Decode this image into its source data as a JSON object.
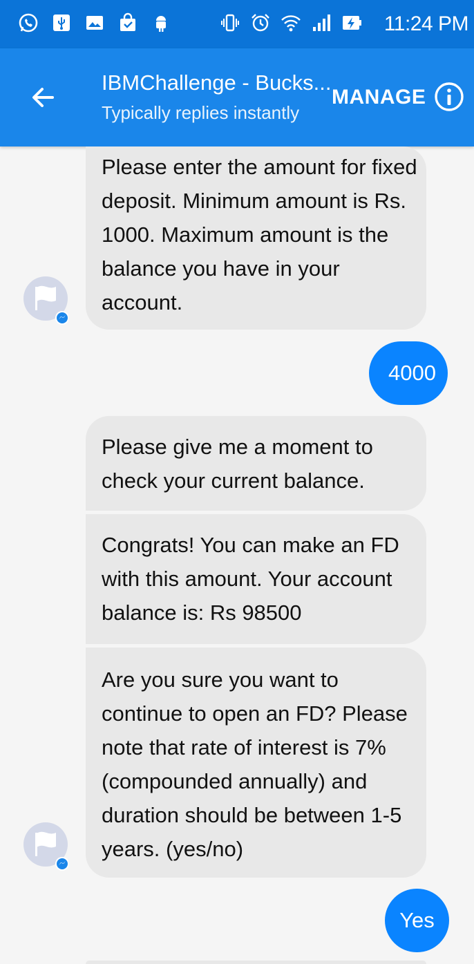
{
  "status_bar": {
    "time": "11:24 PM",
    "left_icons": [
      "whatsapp-icon",
      "usb-icon",
      "image-icon",
      "shopping-bag-icon",
      "android-icon"
    ],
    "right_icons": [
      "vibrate-icon",
      "alarm-icon",
      "wifi-icon",
      "signal-icon",
      "battery-charging-icon"
    ]
  },
  "header": {
    "title": "IBMChallenge - Bucks...",
    "subtitle": "Typically replies instantly",
    "manage_label": "MANAGE",
    "back_icon": "back-arrow-icon",
    "info_icon": "info-icon"
  },
  "messages": [
    {
      "sender": "bot",
      "text": "Please enter the amount for fixed deposit. Minimum amount is Rs. 1000. Maximum amount is the balance you have in your account."
    },
    {
      "sender": "user",
      "text": "4000"
    },
    {
      "sender": "bot",
      "text": "Please give me a moment to check your current balance."
    },
    {
      "sender": "bot",
      "text": "Congrats! You can make an FD with this amount. Your account balance is: Rs 98500"
    },
    {
      "sender": "bot",
      "text": "Are you sure you want to continue to open an FD? Please note that rate of interest is 7% (compounded annually) and duration should be between 1-5 years. (yes/no)"
    },
    {
      "sender": "user",
      "text": "Yes"
    }
  ],
  "colors": {
    "status_bar": "#0b74d8",
    "app_bar": "#1a86ea",
    "user_bubble": "#0a84ff",
    "bot_bubble": "#e8e8e8"
  }
}
